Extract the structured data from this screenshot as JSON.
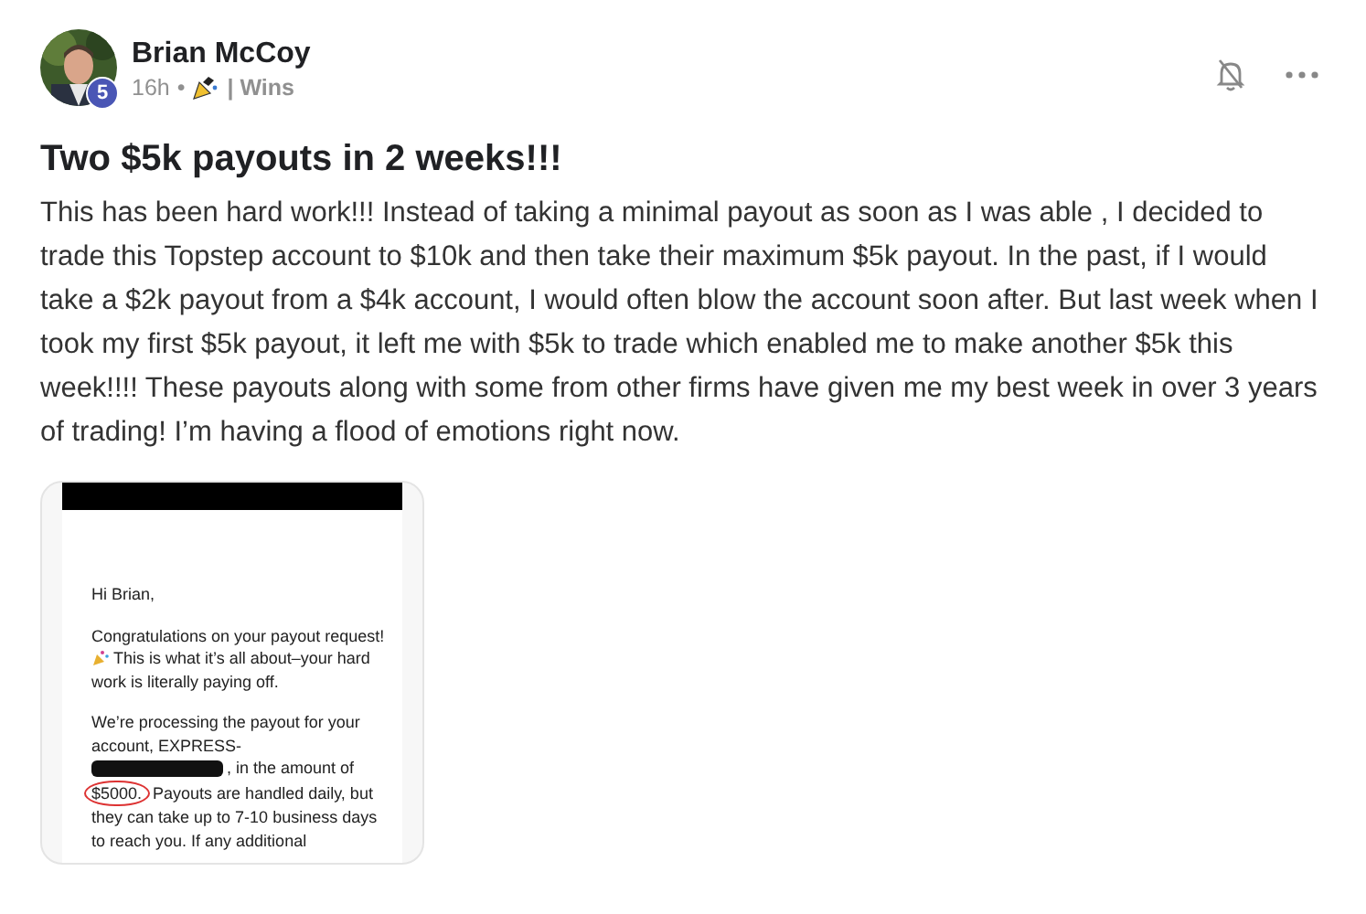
{
  "author": {
    "name": "Brian McCoy",
    "level": "5",
    "time": "16h",
    "separator": "•",
    "category": "| Wins"
  },
  "title": "Two $5k payouts in 2 weeks!!!",
  "body": "This has been hard work!!! Instead of taking a minimal payout as soon as I was able , I decided to trade this Topstep account to $10k and then take their maximum $5k payout. In the past, if I would take a $2k payout from a $4k account, I would often blow the account soon after. But last week when I took my first $5k payout, it left me with $5k to trade which enabled me to make another $5k this week!!!! These payouts along with some from other firms have given me my best week in over 3 years of trading! I’m having a flood of emotions right now.",
  "attachment": {
    "lines": [
      {
        "kind": "text",
        "text": "Hi Brian,"
      },
      {
        "kind": "gap"
      },
      {
        "kind": "text",
        "text": "Congratulations on your payout request!"
      },
      {
        "kind": "emoji",
        "text": "This is what it’s all about–your hard"
      },
      {
        "kind": "text",
        "text": "work is literally paying off."
      },
      {
        "kind": "gap"
      },
      {
        "kind": "text",
        "text": "We’re processing the payout for your"
      },
      {
        "kind": "text",
        "text": "account, EXPRESS-"
      },
      {
        "kind": "redacted",
        "text": ", in the amount of"
      },
      {
        "kind": "circled",
        "circled": "$5000.",
        "text": "Payouts are handled daily, but"
      },
      {
        "kind": "text",
        "text": "they can take up to 7-10 business days"
      },
      {
        "kind": "text",
        "text": "to reach you. If any additional"
      }
    ]
  }
}
